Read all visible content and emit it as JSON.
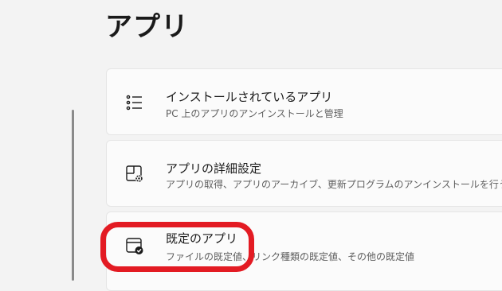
{
  "page": {
    "title": "アプリ"
  },
  "cards": [
    {
      "title": "インストールされているアプリ",
      "subtitle": "PC 上のアプリのアンインストールと管理",
      "icon": "app-list-icon"
    },
    {
      "title": "アプリの詳細設定",
      "subtitle": "アプリの取得、アプリのアーカイブ、更新プログラムのアンインストールを行う場",
      "icon": "app-settings-icon"
    },
    {
      "title": "既定のアプリ",
      "subtitle": "ファイルの既定値、リンク種類の既定値、その他の既定値",
      "icon": "default-apps-icon"
    }
  ],
  "colors": {
    "background": "#f3f3f3",
    "card": "#fbfbfb",
    "highlight": "#e31b23"
  }
}
